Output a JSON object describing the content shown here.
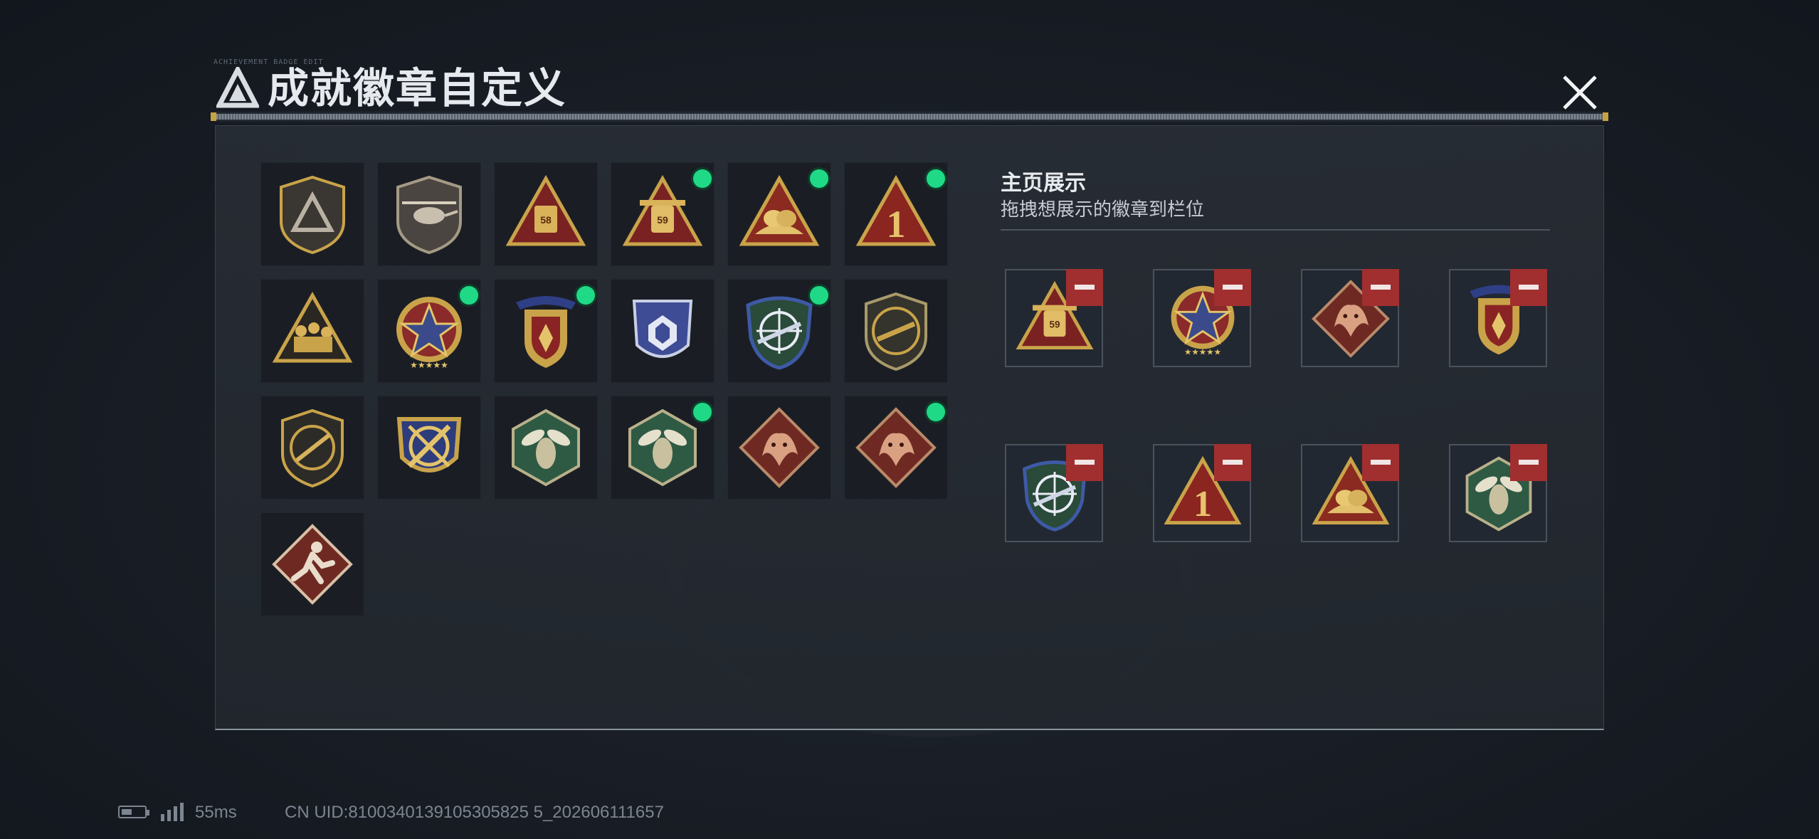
{
  "header": {
    "title": "成就徽章自定义",
    "tiny_text": "ACHIEVEMENT BADGE EDIT"
  },
  "badges": [
    {
      "icon": "shield-delta-logo-icon",
      "new": false
    },
    {
      "icon": "helicopter-shield-icon",
      "new": false
    },
    {
      "icon": "triangle-58-box-icon",
      "new": false
    },
    {
      "icon": "triangle-59-tank-icon",
      "new": true
    },
    {
      "icon": "triangle-helmet-icon",
      "new": true
    },
    {
      "icon": "triangle-number-1-icon",
      "new": true
    },
    {
      "icon": "triangle-soldiers-icon",
      "new": false
    },
    {
      "icon": "star-medal-icon",
      "new": true
    },
    {
      "icon": "rank-shield-medal-icon",
      "new": true
    },
    {
      "icon": "blue-crest-icon",
      "new": false
    },
    {
      "icon": "crosshair-rifle-shield-icon",
      "new": true
    },
    {
      "icon": "rifle-shield-icon",
      "new": false
    },
    {
      "icon": "knife-shield-icon",
      "new": false
    },
    {
      "icon": "crossed-blades-shield-icon",
      "new": false
    },
    {
      "icon": "hornet-hexagon-icon",
      "new": false
    },
    {
      "icon": "hornet-hexagon-icon",
      "new": true
    },
    {
      "icon": "dragon-diamond-icon",
      "new": false
    },
    {
      "icon": "dragon-diamond-icon",
      "new": true
    },
    {
      "icon": "runner-diamond-icon",
      "new": false
    }
  ],
  "showcase": {
    "title": "主页展示",
    "subtitle": "拖拽想展示的徽章到栏位",
    "slots": [
      {
        "icon": "triangle-59-tank-icon"
      },
      {
        "icon": "star-medal-icon"
      },
      {
        "icon": "dragon-diamond-icon"
      },
      {
        "icon": "rank-shield-medal-icon"
      },
      {
        "icon": "crosshair-rifle-shield-icon"
      },
      {
        "icon": "triangle-number-1-icon"
      },
      {
        "icon": "triangle-helmet-icon"
      },
      {
        "icon": "hornet-hexagon-icon"
      }
    ]
  },
  "footer": {
    "ping": "55ms",
    "uid": "CN UID:8100340139105305825 5_202606111657"
  },
  "colors": {
    "new_dot": "#1fd987",
    "remove_button": "#a12f2f",
    "gold": "#c9a34a",
    "panel": "#282d35"
  }
}
